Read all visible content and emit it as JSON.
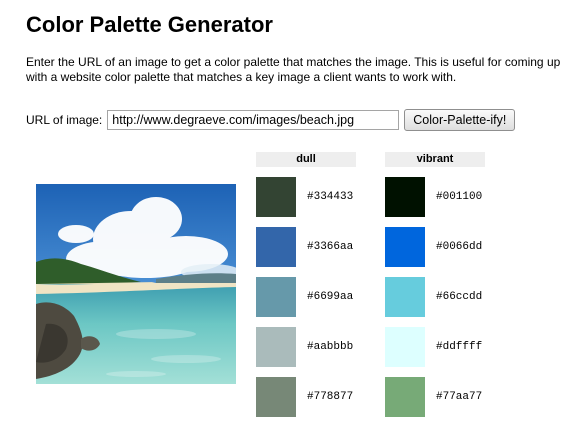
{
  "page": {
    "title": "Color Palette Generator",
    "intro": "Enter the URL of an image to get a color palette that matches the image. This is useful for coming up with a website color palette that matches a key image a client wants to work with."
  },
  "form": {
    "url_label": "URL of image:",
    "url_value": "http://www.degraeve.com/images/beach.jpg",
    "submit_label": "Color-Palette-ify!"
  },
  "palettes": {
    "dull": {
      "header": "dull",
      "colors": [
        "#334433",
        "#3366aa",
        "#6699aa",
        "#aabbbb",
        "#778877"
      ]
    },
    "vibrant": {
      "header": "vibrant",
      "colors": [
        "#001100",
        "#0066dd",
        "#66ccdd",
        "#ddffff",
        "#77aa77"
      ]
    }
  }
}
